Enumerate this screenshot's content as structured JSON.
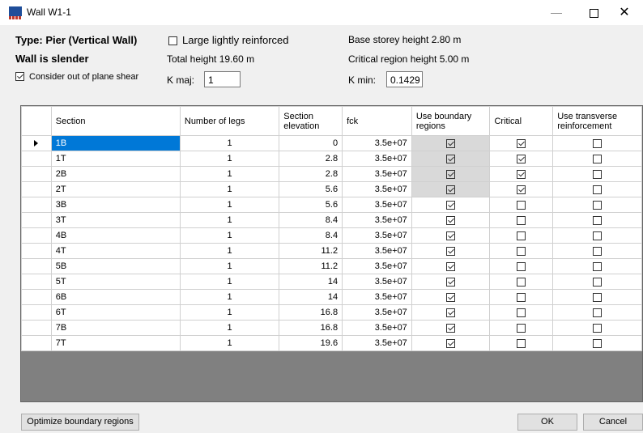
{
  "window": {
    "title": "Wall W1-1",
    "minimize": "—",
    "close": "✕"
  },
  "info": {
    "type_label": "Type: Pier (Vertical Wall)",
    "slender_label": "Wall is slender",
    "consider_label": "Consider out of plane shear",
    "consider_checked": true,
    "large_lightly_label": "Large lightly reinforced",
    "large_lightly_checked": false,
    "total_height": "Total height 19.60 m",
    "kmaj_label": "K maj:",
    "kmaj_value": "1",
    "base_storey": "Base storey height 2.80 m",
    "critical_region": "Critical  region height 5.00 m",
    "kmin_label": "K min:",
    "kmin_value": "0.1429"
  },
  "table": {
    "columns": [
      "Section",
      "Number of legs",
      "Section elevation",
      "fck",
      "Use boundary regions",
      "Critical",
      "Use transverse reinforcement"
    ],
    "rows": [
      {
        "section": "1B",
        "legs": "1",
        "elev": "0",
        "fck": "3.5e+07",
        "boundary": true,
        "critical": true,
        "transverse": false,
        "selected": true
      },
      {
        "section": "1T",
        "legs": "1",
        "elev": "2.8",
        "fck": "3.5e+07",
        "boundary": true,
        "critical": true,
        "transverse": false
      },
      {
        "section": "2B",
        "legs": "1",
        "elev": "2.8",
        "fck": "3.5e+07",
        "boundary": true,
        "critical": true,
        "transverse": false
      },
      {
        "section": "2T",
        "legs": "1",
        "elev": "5.6",
        "fck": "3.5e+07",
        "boundary": true,
        "critical": true,
        "transverse": false
      },
      {
        "section": "3B",
        "legs": "1",
        "elev": "5.6",
        "fck": "3.5e+07",
        "boundary": true,
        "critical": false,
        "transverse": false
      },
      {
        "section": "3T",
        "legs": "1",
        "elev": "8.4",
        "fck": "3.5e+07",
        "boundary": true,
        "critical": false,
        "transverse": false
      },
      {
        "section": "4B",
        "legs": "1",
        "elev": "8.4",
        "fck": "3.5e+07",
        "boundary": true,
        "critical": false,
        "transverse": false
      },
      {
        "section": "4T",
        "legs": "1",
        "elev": "11.2",
        "fck": "3.5e+07",
        "boundary": true,
        "critical": false,
        "transverse": false
      },
      {
        "section": "5B",
        "legs": "1",
        "elev": "11.2",
        "fck": "3.5e+07",
        "boundary": true,
        "critical": false,
        "transverse": false
      },
      {
        "section": "5T",
        "legs": "1",
        "elev": "14",
        "fck": "3.5e+07",
        "boundary": true,
        "critical": false,
        "transverse": false
      },
      {
        "section": "6B",
        "legs": "1",
        "elev": "14",
        "fck": "3.5e+07",
        "boundary": true,
        "critical": false,
        "transverse": false
      },
      {
        "section": "6T",
        "legs": "1",
        "elev": "16.8",
        "fck": "3.5e+07",
        "boundary": true,
        "critical": false,
        "transverse": false
      },
      {
        "section": "7B",
        "legs": "1",
        "elev": "16.8",
        "fck": "3.5e+07",
        "boundary": true,
        "critical": false,
        "transverse": false
      },
      {
        "section": "7T",
        "legs": "1",
        "elev": "19.6",
        "fck": "3.5e+07",
        "boundary": true,
        "critical": false,
        "transverse": false
      }
    ]
  },
  "buttons": {
    "optimize": "Optimize boundary regions",
    "ok": "OK",
    "cancel": "Cancel"
  },
  "colors": {
    "selection": "#0078d7",
    "locked_cell": "#d9d9d9",
    "brand_icon": "#1f4e9a"
  }
}
